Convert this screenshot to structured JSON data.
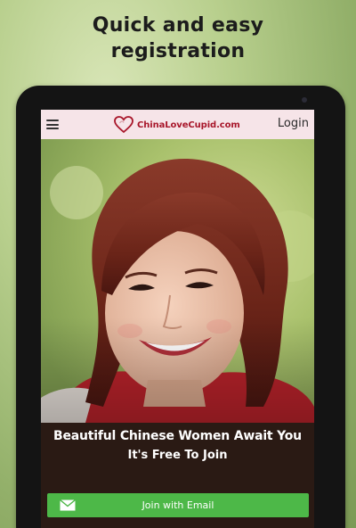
{
  "promo": {
    "line1": "Quick and easy",
    "line2": "registration"
  },
  "appbar": {
    "menu_icon": "hamburger-icon",
    "logo_text": "ChinaLoveCupid.com",
    "logo_icon": "heart-logo-icon",
    "login_label": "Login"
  },
  "hero": {
    "headline": "Beautiful Chinese Women Await You",
    "subhead": "It's Free To Join"
  },
  "cta": {
    "icon": "envelope-icon",
    "label": "Join with Email"
  },
  "colors": {
    "brand_red": "#a8162a",
    "appbar_bg": "#f6e4e8",
    "cta_green": "#4db848",
    "device_frame": "#141414"
  }
}
